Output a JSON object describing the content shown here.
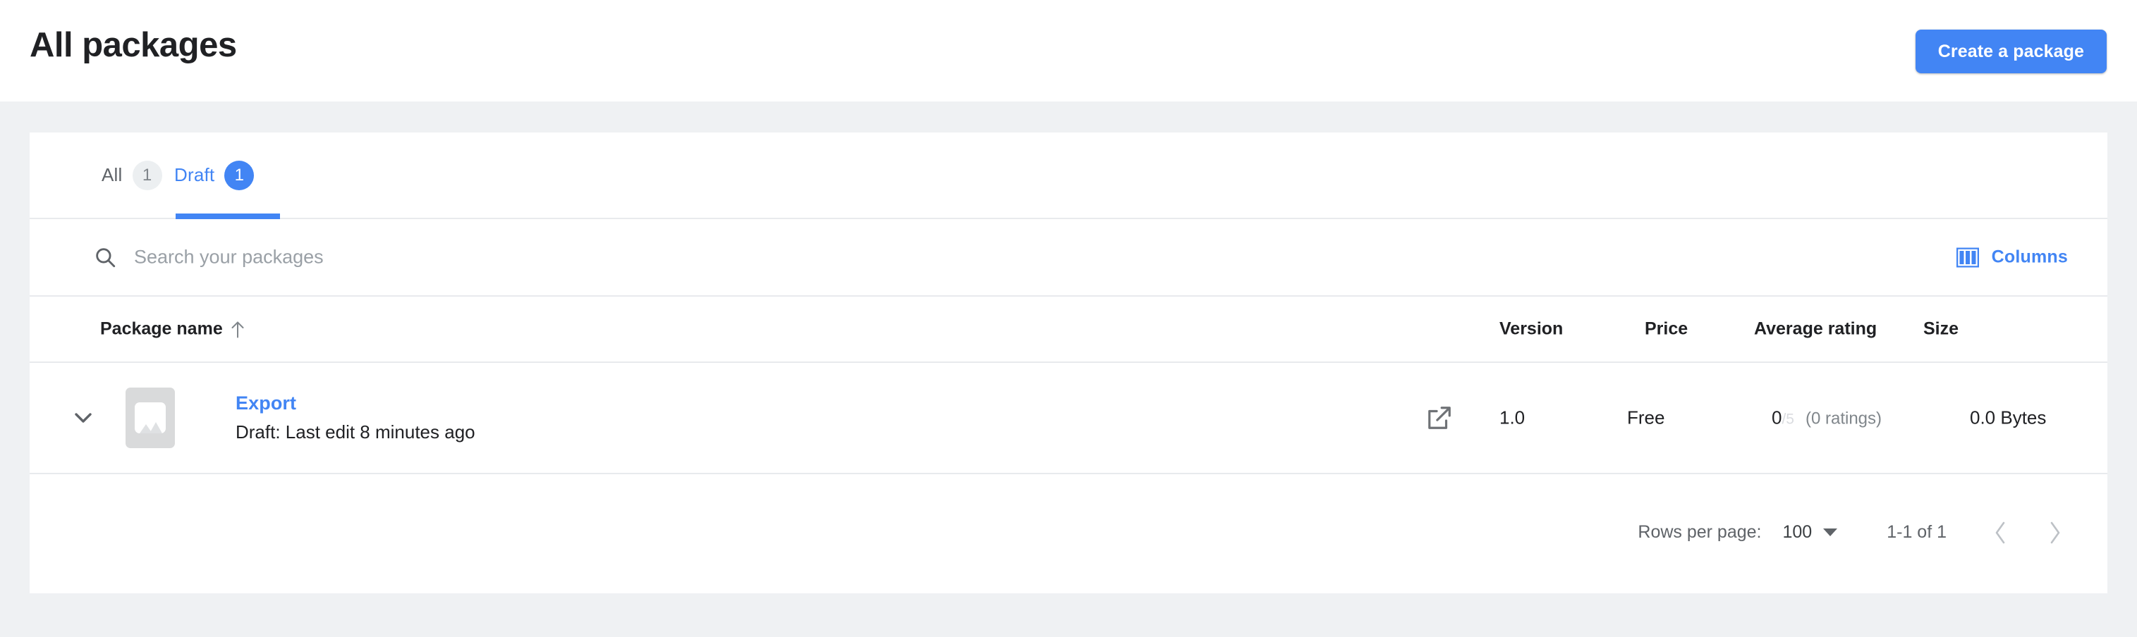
{
  "header": {
    "title": "All packages",
    "create_button_label": "Create a package"
  },
  "tabs": [
    {
      "label": "All",
      "count": "1",
      "active": false
    },
    {
      "label": "Draft",
      "count": "1",
      "active": true
    }
  ],
  "search": {
    "placeholder": "Search your packages",
    "value": "",
    "icon": "search-icon"
  },
  "columns_button": {
    "label": "Columns",
    "icon": "columns-icon"
  },
  "table": {
    "headers": {
      "package_name": "Package name",
      "version": "Version",
      "price": "Price",
      "average_rating": "Average rating",
      "size": "Size"
    },
    "sort": {
      "column": "Package name",
      "direction": "ascending",
      "icon": "arrow-up-icon"
    },
    "rows": [
      {
        "expand_icon": "chevron-down-icon",
        "thumbnail_icon": "image-placeholder-icon",
        "name": "Export",
        "status": "Draft: Last edit 8 minutes ago",
        "open_icon": "external-link-icon",
        "version": "1.0",
        "price": "Free",
        "rating_value": "0",
        "rating_max": "/5",
        "rating_count": "(0 ratings)",
        "size": "0.0 Bytes"
      }
    ]
  },
  "pagination": {
    "rows_per_page_label": "Rows per page:",
    "rows_per_page_value": "100",
    "range_label": "1-1 of 1",
    "prev_icon": "chevron-left-icon",
    "next_icon": "chevron-right-icon"
  },
  "colors": {
    "accent": "#4285f4",
    "page_background": "#eff1f3",
    "text_primary": "#202124",
    "text_secondary": "#5f6368",
    "divider": "#e8eaed"
  }
}
